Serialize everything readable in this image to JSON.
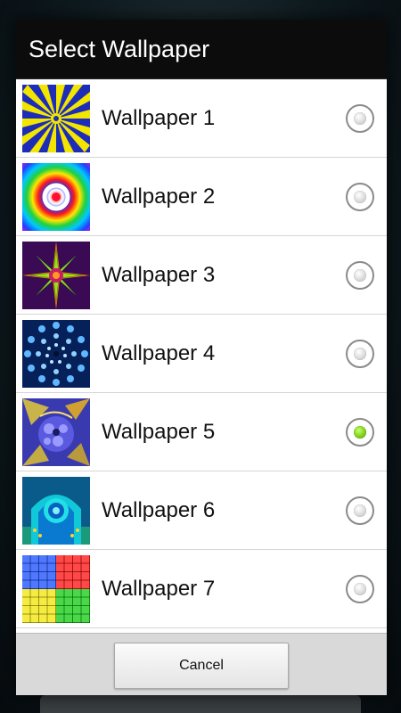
{
  "dialog": {
    "title": "Select Wallpaper",
    "cancel_label": "Cancel"
  },
  "wallpapers": [
    {
      "label": "Wallpaper 1",
      "selected": false,
      "thumbnail": "yellow-blue-spiral-thumbnail"
    },
    {
      "label": "Wallpaper 2",
      "selected": false,
      "thumbnail": "rainbow-rings-thumbnail"
    },
    {
      "label": "Wallpaper 3",
      "selected": false,
      "thumbnail": "green-purple-star-thumbnail"
    },
    {
      "label": "Wallpaper 4",
      "selected": false,
      "thumbnail": "blue-bubble-tunnel-thumbnail"
    },
    {
      "label": "Wallpaper 5",
      "selected": true,
      "thumbnail": "fractal-thumbnail"
    },
    {
      "label": "Wallpaper 6",
      "selected": false,
      "thumbnail": "teal-fractal-thumbnail"
    },
    {
      "label": "Wallpaper 7",
      "selected": false,
      "thumbnail": "color-grid-thumbnail"
    }
  ],
  "colors": {
    "selected_radio": "#7fd21a",
    "dialog_header": "#0c0c0c"
  }
}
